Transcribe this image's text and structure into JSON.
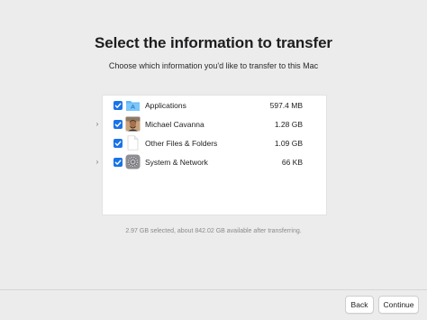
{
  "header": {
    "title": "Select the information to transfer",
    "subtitle": "Choose which information you'd like to transfer to this Mac"
  },
  "items": [
    {
      "label": "Applications",
      "size": "597.4 MB",
      "checked": true,
      "expandable": false,
      "icon": "applications-folder-icon"
    },
    {
      "label": "Michael Cavanna",
      "size": "1.28 GB",
      "checked": true,
      "expandable": true,
      "icon": "user-avatar-icon"
    },
    {
      "label": "Other Files & Folders",
      "size": "1.09 GB",
      "checked": true,
      "expandable": false,
      "icon": "blank-document-icon"
    },
    {
      "label": "System & Network",
      "size": "66 KB",
      "checked": true,
      "expandable": true,
      "icon": "system-settings-gear-icon"
    }
  ],
  "status": "2.97 GB selected, about 842.02 GB available after transferring.",
  "buttons": {
    "back": "Back",
    "continue": "Continue"
  },
  "colors": {
    "accent": "#1a73e8",
    "background": "#ececec"
  }
}
